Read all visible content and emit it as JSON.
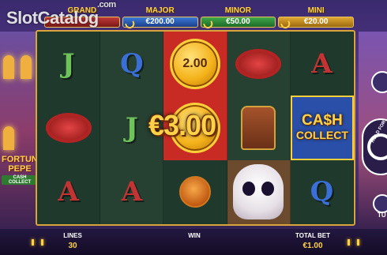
{
  "watermark": {
    "text": "SlotCatalog",
    "suffix": ".com"
  },
  "game_logo": {
    "line1": "FORTUNA",
    "line2": "PEPE",
    "line3": "CASH COLLECT"
  },
  "jackpots": [
    {
      "name": "GRAND",
      "value": "",
      "color": "#c23a3a"
    },
    {
      "name": "MAJOR",
      "value": "€200.00",
      "color": "#3a7ad8"
    },
    {
      "name": "MINOR",
      "value": "€50.00",
      "color": "#3fa84a"
    },
    {
      "name": "MINI",
      "value": "€20.00",
      "color": "#e2a833"
    }
  ],
  "reels": {
    "grid": [
      [
        "J",
        "Q",
        "coin",
        "sombrero",
        "A"
      ],
      [
        "sombrero",
        "J",
        "coin",
        "idol",
        "cash-collect"
      ],
      [
        "A",
        "A",
        "drink",
        "skull",
        "Q"
      ]
    ],
    "coin_value": "2.00",
    "win_overlay": "€3.00",
    "cash_collect": {
      "line1": "CA$H",
      "line2": "COLLECT"
    }
  },
  "controls": {
    "hold_label": "HOLD FOR",
    "turbo_label": "TU"
  },
  "footer": {
    "lines_label": "LINES",
    "lines_value": "30",
    "win_label": "WIN",
    "win_value": "",
    "bet_label": "TOTAL BET",
    "bet_value": "€1.00"
  }
}
